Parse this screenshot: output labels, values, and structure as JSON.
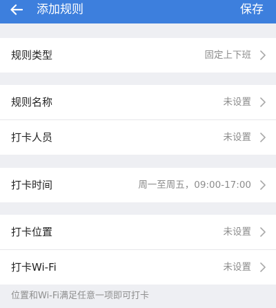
{
  "header": {
    "title": "添加规则",
    "save_label": "保存",
    "back_icon": "arrow-left-icon",
    "background_color": "#3d7fdd"
  },
  "rule_type": {
    "label": "规则类型",
    "value": "固定上下班"
  },
  "basic": [
    {
      "label": "规则名称",
      "value": "未设置"
    },
    {
      "label": "打卡人员",
      "value": "未设置"
    }
  ],
  "time": {
    "label": "打卡时间",
    "value": "周一至周五，09:00-17:00"
  },
  "location": [
    {
      "label": "打卡位置",
      "value": "未设置"
    },
    {
      "label": "打卡Wi-Fi",
      "value": "未设置"
    }
  ],
  "footnote": "位置和Wi-Fi满足任意一项即可打卡",
  "chevron_icon": "chevron-right-icon"
}
